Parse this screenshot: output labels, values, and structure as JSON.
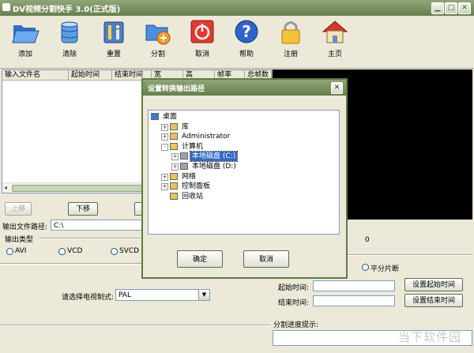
{
  "window": {
    "title": "DV视频分割快手 3.0(正式版)"
  },
  "toolbar": [
    {
      "label": "添加",
      "icon": "folder-open-icon"
    },
    {
      "label": "清除",
      "icon": "database-icon"
    },
    {
      "label": "重置",
      "icon": "tools-icon"
    },
    {
      "label": "分割",
      "icon": "split-folder-icon"
    },
    {
      "label": "取消",
      "icon": "power-stop-icon"
    },
    {
      "label": "帮助",
      "icon": "help-icon"
    },
    {
      "label": "注册",
      "icon": "lock-icon"
    },
    {
      "label": "主页",
      "icon": "home-icon"
    }
  ],
  "file_table": {
    "columns": [
      "输入文件名",
      "起始时间",
      "结束时间",
      "宽",
      "高",
      "帧率",
      "总帧数"
    ]
  },
  "list_buttons": {
    "up": "上移",
    "down": "下移"
  },
  "output": {
    "path_label": "输出文件路径:",
    "path_value": "C:\\",
    "type_label": "输出类型",
    "types": [
      "AVI",
      "VCD",
      "SVCD"
    ]
  },
  "tv_system": {
    "label": "请选择电视制式:",
    "value": "PAL"
  },
  "split": {
    "count_value": "0",
    "even_split_label": "平分片断",
    "start_label": "起始时间:",
    "end_label": "结束时间:",
    "set_start_button": "设置起始时间",
    "set_end_button": "设置结束时间",
    "progress_label": "分割进度提示:"
  },
  "dialog": {
    "title": "设置转换输出路径",
    "tree": [
      {
        "label": "桌面",
        "level": 0,
        "expander": ""
      },
      {
        "label": "库",
        "level": 1,
        "expander": "+"
      },
      {
        "label": "Administrator",
        "level": 1,
        "expander": "+"
      },
      {
        "label": "计算机",
        "level": 1,
        "expander": "-"
      },
      {
        "label": "本地磁盘 (C:)",
        "level": 2,
        "expander": "+",
        "selected": true
      },
      {
        "label": "本地磁盘 (D:)",
        "level": 2,
        "expander": "+"
      },
      {
        "label": "网络",
        "level": 1,
        "expander": "+"
      },
      {
        "label": "控制面板",
        "level": 1,
        "expander": "+"
      },
      {
        "label": "回收站",
        "level": 1,
        "expander": ""
      }
    ],
    "ok_button": "确定",
    "cancel_button": "取消"
  },
  "watermark": "当下软件园",
  "colors": {
    "title_bar": "#667f4e",
    "selection": "#316ac5",
    "preview": "#000000"
  }
}
